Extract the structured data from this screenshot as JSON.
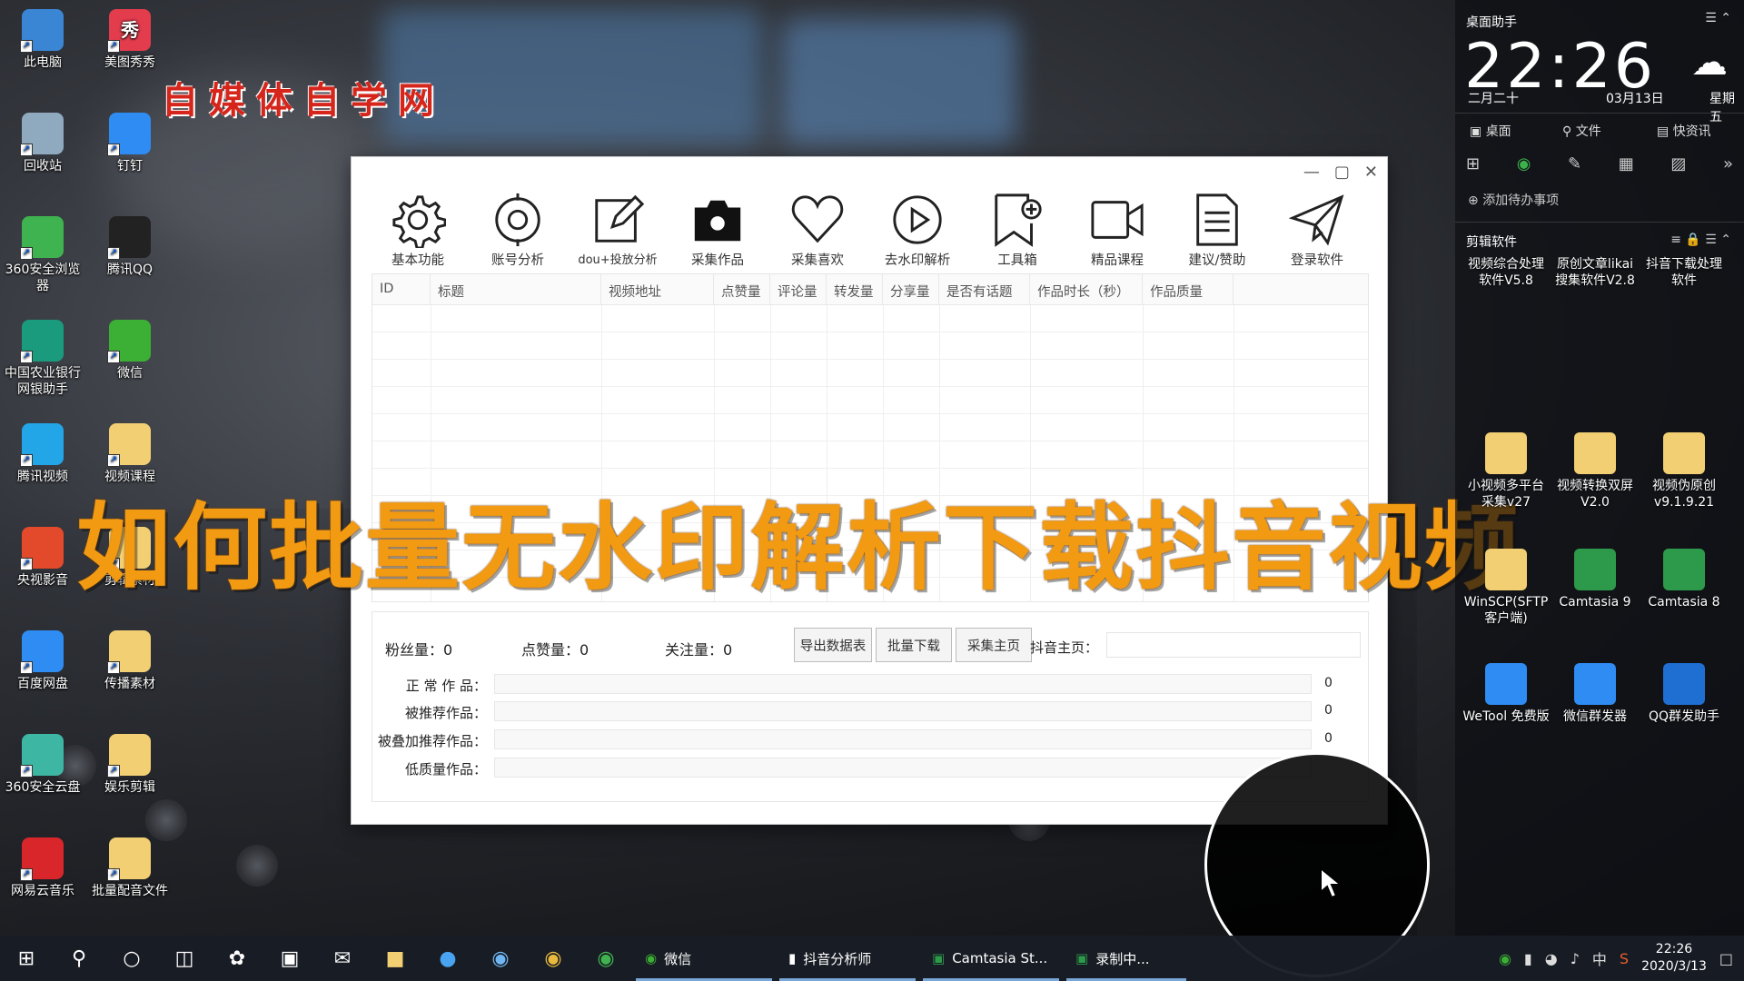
{
  "desktop_icons": [
    {
      "label": "此电脑",
      "icon": "computer-icon",
      "color": "#3a86d4"
    },
    {
      "label": "美图秀秀",
      "icon": "meitu-icon",
      "color": "#e23c4d",
      "glyph": "秀"
    },
    {
      "label": "回收站",
      "icon": "recycle-bin-icon",
      "color": "#8fa9bf"
    },
    {
      "label": "钉钉",
      "icon": "dingtalk-icon",
      "color": "#2f8cf2"
    },
    {
      "label": "360安全浏览器",
      "icon": "360-browser-icon",
      "color": "#3fb34f"
    },
    {
      "label": "腾讯QQ",
      "icon": "qq-icon",
      "color": "#222"
    },
    {
      "label": "中国农业银行网银助手",
      "icon": "abc-bank-icon",
      "color": "#1a9b7d"
    },
    {
      "label": "微信",
      "icon": "wechat-icon",
      "color": "#3cb034"
    },
    {
      "label": "腾讯视频",
      "icon": "tencent-video-icon",
      "color": "#22a6e8"
    },
    {
      "label": "视频课程",
      "icon": "folder-icon",
      "color": "#f2cf72"
    },
    {
      "label": "央视影音",
      "icon": "cctv-icon",
      "color": "#e24a2b"
    },
    {
      "label": "剪辑素材",
      "icon": "folder-icon",
      "color": "#f2cf72"
    },
    {
      "label": "百度网盘",
      "icon": "baidu-netdisk-icon",
      "color": "#2f8cf2"
    },
    {
      "label": "传播素材",
      "icon": "folder-icon",
      "color": "#f2cf72"
    },
    {
      "label": "360安全云盘",
      "icon": "360-cloud-icon",
      "color": "#3db7a4"
    },
    {
      "label": "娱乐剪辑",
      "icon": "folder-icon",
      "color": "#f2cf72"
    },
    {
      "label": "网易云音乐",
      "icon": "netease-music-icon",
      "color": "#d9262b"
    },
    {
      "label": "批量配音文件",
      "icon": "folder-icon",
      "color": "#f2cf72"
    }
  ],
  "watermark": "自媒体自学网",
  "app": {
    "toolbar": [
      {
        "label": "基本功能",
        "icon": "gear-icon"
      },
      {
        "label": "账号分析",
        "icon": "target-icon"
      },
      {
        "label": "dou+投放分析",
        "icon": "edit-icon"
      },
      {
        "label": "采集作品",
        "icon": "camera-icon"
      },
      {
        "label": "采集喜欢",
        "icon": "heart-icon"
      },
      {
        "label": "去水印解析",
        "icon": "play-icon"
      },
      {
        "label": "工具箱",
        "icon": "bookmark-icon"
      },
      {
        "label": "精品课程",
        "icon": "video-icon"
      },
      {
        "label": "建议/赞助",
        "icon": "document-icon"
      },
      {
        "label": "登录软件",
        "icon": "send-icon"
      }
    ],
    "columns": [
      "ID",
      "标题",
      "视频地址",
      "点赞量",
      "评论量",
      "转发量",
      "分享量",
      "是否有话题",
      "作品时长（秒）",
      "作品质量"
    ],
    "stats": {
      "fans_label": "粉丝量：",
      "fans_value": "0",
      "likes_label": "点赞量：",
      "likes_value": "0",
      "follow_label": "关注量：",
      "follow_value": "0"
    },
    "buttons": {
      "export": "导出数据表",
      "batch_download": "批量下载",
      "collect_home": "采集主页"
    },
    "homepage_label": "抖音主页：",
    "rows": [
      {
        "label": "正 常 作 品：",
        "value": "0"
      },
      {
        "label": "被推荐作品：",
        "value": "0"
      },
      {
        "label": "被叠加推荐作品：",
        "value": "0"
      },
      {
        "label": "低质量作品：",
        "value": ""
      }
    ]
  },
  "overlay_title": "如何批量无水印解析下载抖音视频",
  "panel": {
    "title": "桌面助手",
    "time": "22:26",
    "lunar": "二月二十",
    "date": "03月13日",
    "weekday": "星期五",
    "quick": [
      "桌面",
      "文件",
      "快资讯"
    ],
    "todo": "添加待办事项",
    "section": "剪辑软件",
    "apps": [
      {
        "label": "视频综合处理软件V5.8",
        "icon": "app-icon",
        "color": "#e9e9e9"
      },
      {
        "label": "原创文章likai搜集软件V2.8",
        "icon": "app-icon",
        "color": "#e9e9e9"
      },
      {
        "label": "抖音下载处理软件",
        "icon": "app-icon",
        "color": "#e9e9e9"
      },
      {
        "label": "小视频多平台采集v27",
        "icon": "folder-zip-icon",
        "color": "#f2cf72"
      },
      {
        "label": "视频转换双屏V2.0",
        "icon": "folder-zip-icon",
        "color": "#f2cf72"
      },
      {
        "label": "视频伪原创v9.1.9.21",
        "icon": "folder-zip-icon",
        "color": "#f2cf72"
      },
      {
        "label": "WinSCP(SFTP客户端)",
        "icon": "winscp-icon",
        "color": "#f2cf72"
      },
      {
        "label": "Camtasia 9",
        "icon": "camtasia-icon",
        "color": "#2c9a4a"
      },
      {
        "label": "Camtasia 8",
        "icon": "camtasia-icon",
        "color": "#2c9a4a"
      },
      {
        "label": "WeTool 免费版",
        "icon": "wetool-icon",
        "color": "#2f8cf2"
      },
      {
        "label": "微信群发器",
        "icon": "wechat-bulk-icon",
        "color": "#2f8cf2"
      },
      {
        "label": "QQ群发助手",
        "icon": "qq-bulk-icon",
        "color": "#1e6fd1"
      }
    ]
  },
  "taskbar": {
    "apps": [
      {
        "label": "微信",
        "icon": "wechat-icon"
      },
      {
        "label": "抖音分析师",
        "icon": "chart-icon"
      },
      {
        "label": "Camtasia St...",
        "icon": "camtasia-icon"
      },
      {
        "label": "录制中...",
        "icon": "camtasia-icon"
      }
    ],
    "time": "22:26",
    "date": "2020/3/13"
  }
}
